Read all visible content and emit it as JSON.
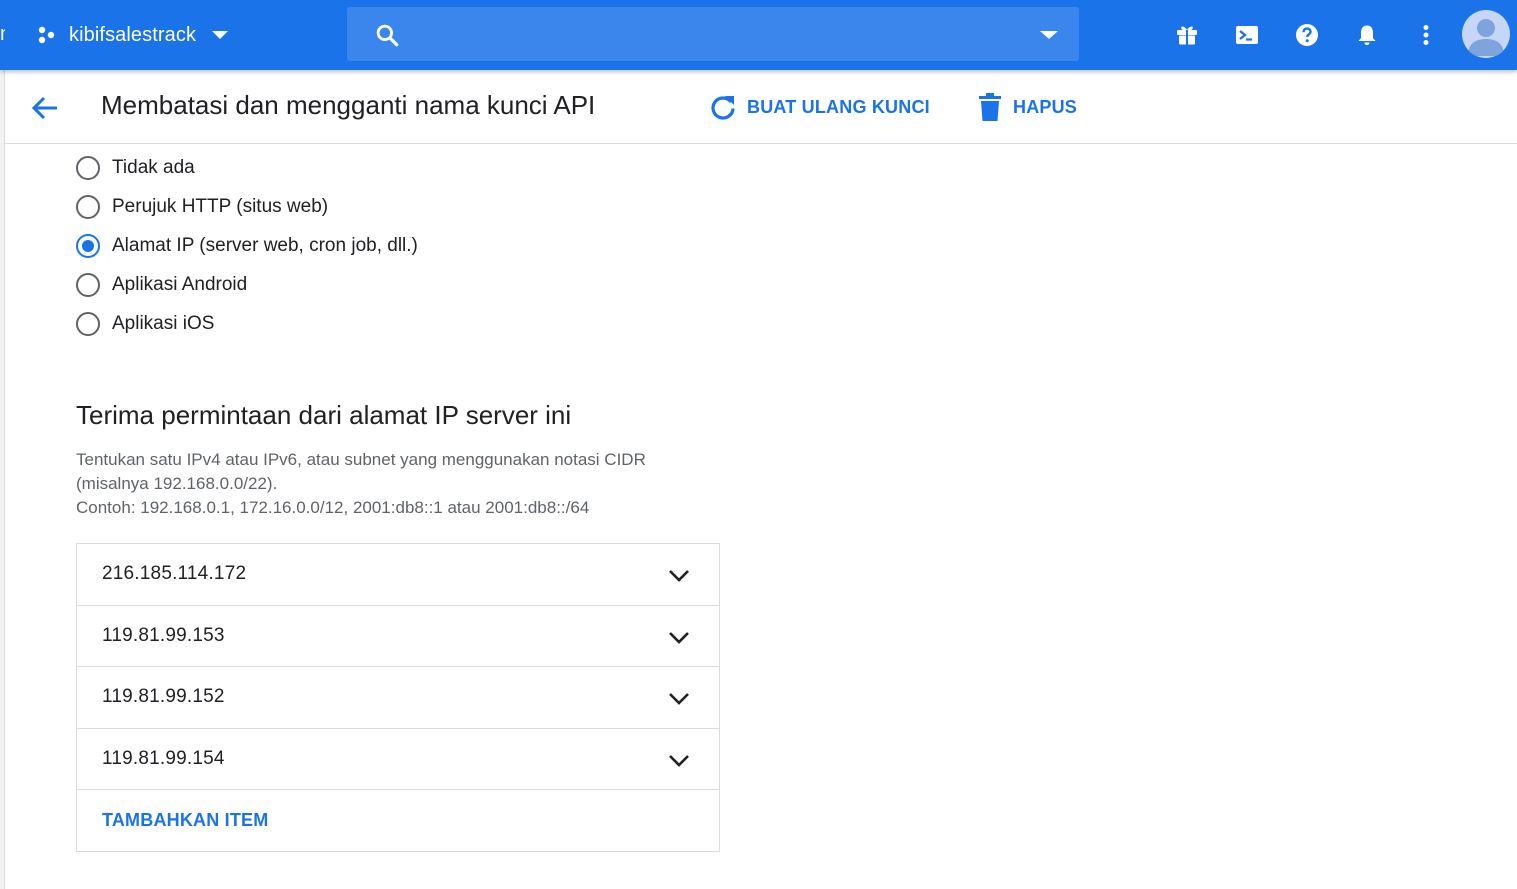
{
  "topbar": {
    "project_name": "kibifsalestrack",
    "search_value": "",
    "edge_glyph": "n",
    "icons": [
      "gift-icon",
      "cloud-shell-icon",
      "help-icon",
      "notifications-icon",
      "more-vert-icon",
      "account-avatar"
    ]
  },
  "header": {
    "title": "Membatasi dan mengganti nama kunci API",
    "regenerate_label": "BUAT ULANG KUNCI",
    "delete_label": "HAPUS"
  },
  "restrictions": {
    "options": [
      {
        "label": "Tidak ada",
        "checked": false
      },
      {
        "label": "Perujuk HTTP (situs web)",
        "checked": false
      },
      {
        "label": "Alamat IP (server web, cron job, dll.)",
        "checked": true
      },
      {
        "label": "Aplikasi Android",
        "checked": false
      },
      {
        "label": "Aplikasi iOS",
        "checked": false
      }
    ]
  },
  "ip_section": {
    "title": "Terima permintaan dari alamat IP server ini",
    "desc_line1": "Tentukan satu IPv4 atau IPv6, atau subnet yang menggunakan notasi CIDR",
    "desc_line2": "(misalnya 192.168.0.0/22).",
    "desc_line3": "Contoh: 192.168.0.1, 172.16.0.0/12, 2001:db8::1 atau 2001:db8::/64",
    "items": [
      "216.185.114.172",
      "119.81.99.153",
      "119.81.99.152",
      "119.81.99.154"
    ],
    "add_label": "TAMBAHKAN ITEM"
  },
  "colors": {
    "brand_blue": "#1a73e8",
    "search_bg": "#3b86ec",
    "text_primary": "#202124",
    "text_secondary": "#5f6368",
    "divider": "#dadce0"
  }
}
